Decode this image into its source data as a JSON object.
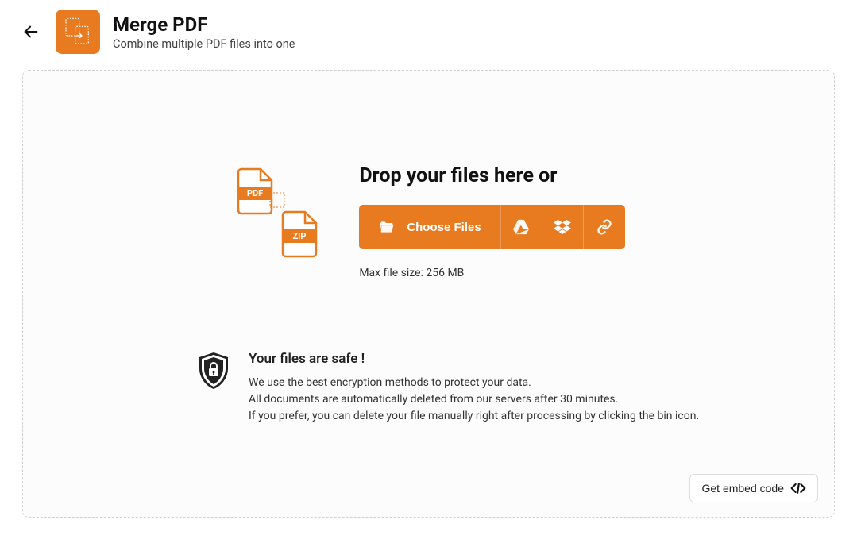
{
  "header": {
    "title": "Merge PDF",
    "subtitle": "Combine multiple PDF files into one"
  },
  "dropzone": {
    "title": "Drop your files here or",
    "choose_label": "Choose Files",
    "max_size_text": "Max file size: 256 MB",
    "decor_pdf": "PDF",
    "decor_zip": "ZIP"
  },
  "safety": {
    "heading": "Your files are safe !",
    "line1": "We use the best encryption methods to protect your data.",
    "line2": "All documents are automatically deleted from our servers after 30 minutes.",
    "line3": "If you prefer, you can delete your file manually right after processing by clicking the bin icon."
  },
  "embed": {
    "label": "Get embed code"
  },
  "colors": {
    "brand": "#E87A1F"
  }
}
